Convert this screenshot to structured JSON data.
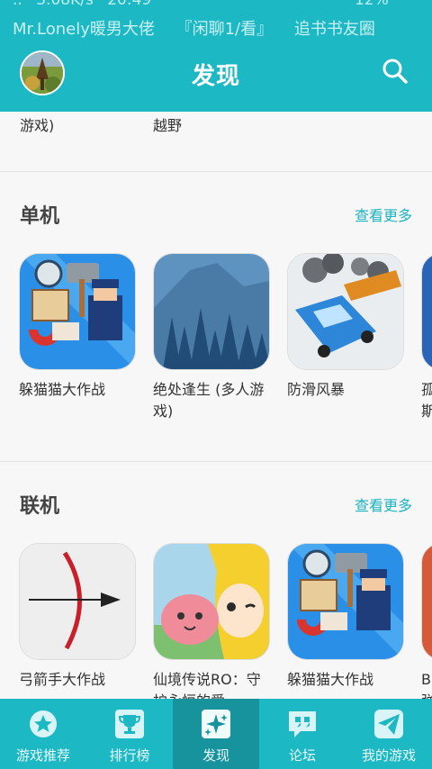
{
  "status_bar": {
    "row1": [
      "..",
      "3.08K/s",
      "20:49",
      "12%"
    ],
    "row2": [
      "Mr.Lonely暖男大佬",
      "『闲聊1/看』",
      "追书书友圈"
    ]
  },
  "header": {
    "title": "发现"
  },
  "previous_row": {
    "left_label": "游戏)",
    "right_label": "越野"
  },
  "sections": [
    {
      "title": "单机",
      "more_label": "查看更多",
      "apps": [
        {
          "name": "躲猫猫大作战"
        },
        {
          "name": "绝处逢生 (多人游戏)"
        },
        {
          "name": "防滑风暴"
        },
        {
          "name": "孤斯"
        }
      ]
    },
    {
      "title": "联机",
      "more_label": "查看更多",
      "apps": [
        {
          "name": "弓箭手大作战"
        },
        {
          "name": "仙境传说RO：守护永恒的爱"
        },
        {
          "name": "躲猫猫大作战"
        },
        {
          "name": "B弹"
        }
      ]
    }
  ],
  "bottom_nav": [
    {
      "label": "游戏推荐",
      "icon": "star-badge-icon"
    },
    {
      "label": "排行榜",
      "icon": "trophy-icon"
    },
    {
      "label": "发现",
      "icon": "sparkle-icon",
      "active": true
    },
    {
      "label": "论坛",
      "icon": "quote-chat-icon"
    },
    {
      "label": "我的游戏",
      "icon": "paper-plane-icon"
    }
  ],
  "colors": {
    "primary": "#1cb9c5",
    "active_tab": "#16939d",
    "link": "#1cb4c1"
  }
}
